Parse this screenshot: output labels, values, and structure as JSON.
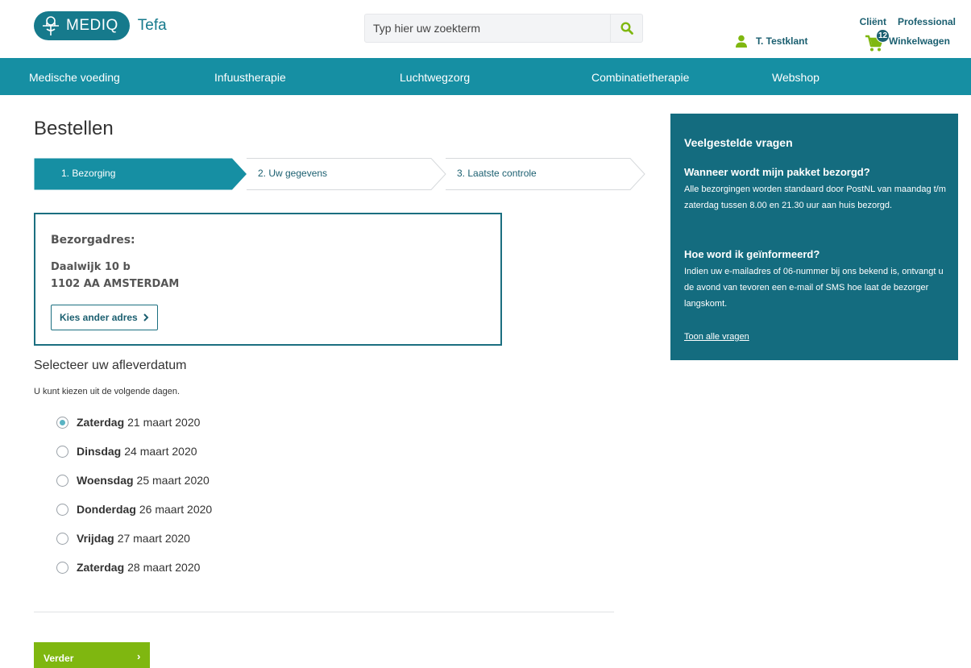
{
  "header": {
    "logo_text": "MEDIQ",
    "logo_sub": "Tefa",
    "search_placeholder": "Typ hier uw zoekterm",
    "user_name": "T. Testklant",
    "top_links": [
      "Cliënt",
      "Professional"
    ],
    "cart_label": "Winkelwagen",
    "cart_count": "12"
  },
  "nav": {
    "items": [
      "Medische voeding",
      "Infuustherapie",
      "Luchtwegzorg",
      "Combinatietherapie",
      "Webshop"
    ]
  },
  "main": {
    "title": "Bestellen",
    "steps": [
      "1. Bezorging",
      "2. Uw gegevens",
      "3. Laatste controle"
    ],
    "address": {
      "title": "Bezorgadres:",
      "line1": "Daalwijk 10 b",
      "line2": "1102 AA AMSTERDAM",
      "button": "Kies ander adres"
    },
    "select_title": "Selecteer uw afleverdatum",
    "select_sub": "U kunt kiezen uit de volgende dagen.",
    "dates": [
      {
        "day": "Zaterdag",
        "date": "21 maart 2020",
        "selected": true
      },
      {
        "day": "Dinsdag",
        "date": "24 maart 2020",
        "selected": false
      },
      {
        "day": "Woensdag",
        "date": "25 maart 2020",
        "selected": false
      },
      {
        "day": "Donderdag",
        "date": "26 maart 2020",
        "selected": false
      },
      {
        "day": "Vrijdag",
        "date": "27 maart 2020",
        "selected": false
      },
      {
        "day": "Zaterdag",
        "date": "28 maart 2020",
        "selected": false
      }
    ],
    "next_button": "Verder"
  },
  "faq": {
    "title": "Veelgestelde vragen",
    "q1": "Wanneer wordt mijn pakket bezorgd?",
    "a1": "Alle bezorgingen worden standaard door PostNL van maandag t/m zaterdag tussen 8.00 en 21.30 uur aan huis bezorgd.",
    "q2": "Hoe word ik geïnformeerd?",
    "a2": "Indien uw e-mailadres of 06-nummer bij ons bekend is, ontvangt u de avond van tevoren een e-mail of SMS hoe laat de bezorger langskomt.",
    "link": "Toon alle vragen"
  },
  "colors": {
    "brand": "#167a8c",
    "nav": "#168fa3",
    "faq": "#146c7f",
    "accent_green": "#7fb710"
  },
  "icons": [
    "mediq-logo-icon",
    "search-icon",
    "user-icon",
    "cart-icon",
    "chevron-right-icon"
  ]
}
